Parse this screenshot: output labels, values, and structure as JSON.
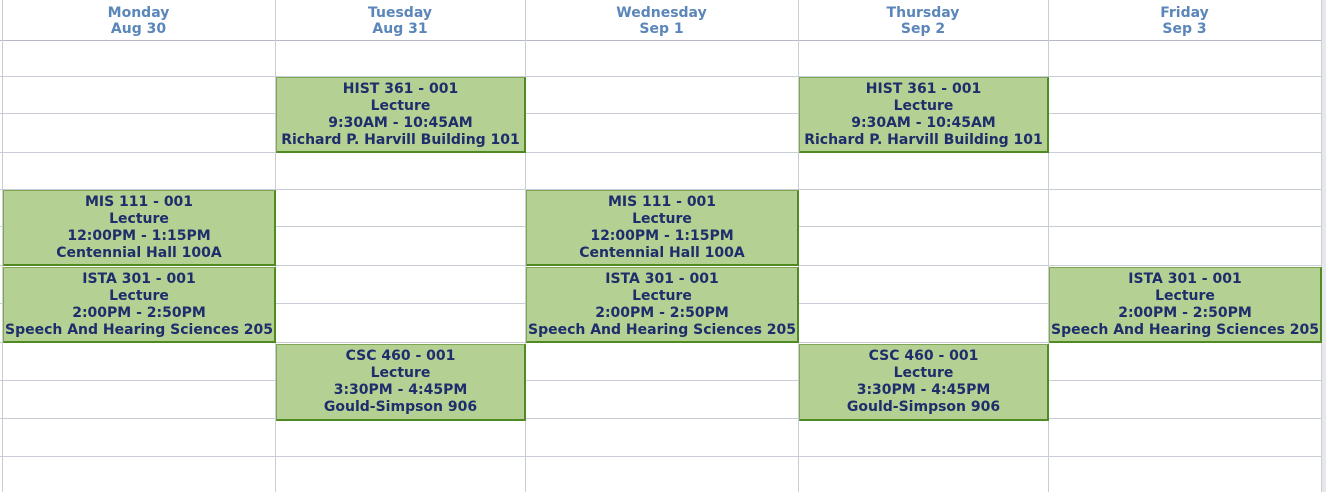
{
  "colors": {
    "header_text": "#5b86b9",
    "event_fill": "#b4d193",
    "event_border": "#4f8a22",
    "event_text": "#1e2d6b",
    "grid_line": "#c9cdd6"
  },
  "days": [
    {
      "name": "Monday",
      "date": "Aug 30"
    },
    {
      "name": "Tuesday",
      "date": "Aug 31"
    },
    {
      "name": "Wednesday",
      "date": "Sep 1"
    },
    {
      "name": "Thursday",
      "date": "Sep 2"
    },
    {
      "name": "Friday",
      "date": "Sep 3"
    }
  ],
  "events": [
    {
      "course": "HIST 361 - 001",
      "type": "Lecture",
      "time": "9:30AM - 10:45AM",
      "location": "Richard P. Harvill Building 101"
    },
    {
      "course": "HIST 361 - 001",
      "type": "Lecture",
      "time": "9:30AM - 10:45AM",
      "location": "Richard P. Harvill Building 101"
    },
    {
      "course": "MIS 111 - 001",
      "type": "Lecture",
      "time": "12:00PM - 1:15PM",
      "location": "Centennial Hall 100A"
    },
    {
      "course": "MIS 111 - 001",
      "type": "Lecture",
      "time": "12:00PM - 1:15PM",
      "location": "Centennial Hall 100A"
    },
    {
      "course": "ISTA 301 - 001",
      "type": "Lecture",
      "time": "2:00PM - 2:50PM",
      "location": "Speech And Hearing Sciences 205"
    },
    {
      "course": "ISTA 301 - 001",
      "type": "Lecture",
      "time": "2:00PM - 2:50PM",
      "location": "Speech And Hearing Sciences 205"
    },
    {
      "course": "ISTA 301 - 001",
      "type": "Lecture",
      "time": "2:00PM - 2:50PM",
      "location": "Speech And Hearing Sciences 205"
    },
    {
      "course": "CSC 460 - 001",
      "type": "Lecture",
      "time": "3:30PM - 4:45PM",
      "location": "Gould-Simpson 906"
    },
    {
      "course": "CSC 460 - 001",
      "type": "Lecture",
      "time": "3:30PM - 4:45PM",
      "location": "Gould-Simpson 906"
    }
  ]
}
